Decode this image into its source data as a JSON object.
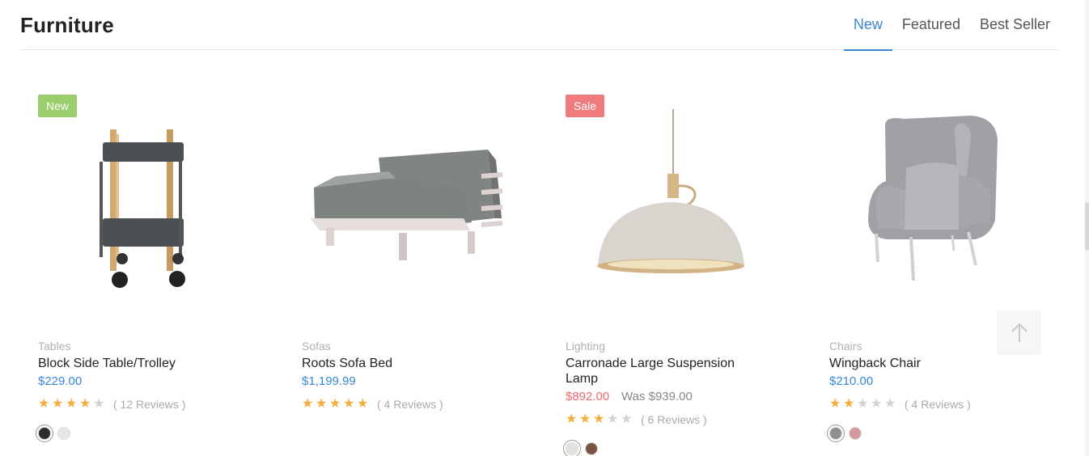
{
  "section": {
    "title": "Furniture",
    "tabs": [
      "New",
      "Featured",
      "Best Seller"
    ],
    "active_tab": "New"
  },
  "products": [
    {
      "badge": "New",
      "category": "Tables",
      "name": "Block Side Table/Trolley",
      "price": "$229.00",
      "rating": 4,
      "reviews": "( 12 Reviews )",
      "swatches": [
        "#2d2d2d",
        "#e6e6e6"
      ],
      "image": "trolley-image"
    },
    {
      "badge": "",
      "category": "Sofas",
      "name": "Roots Sofa Bed",
      "price": "$1,199.99",
      "rating": 5,
      "reviews": "( 4 Reviews )",
      "swatches": [],
      "image": "sofa-bed-image"
    },
    {
      "badge": "Sale",
      "category": "Lighting",
      "name": "Carronade Large Suspension Lamp",
      "price": "$892.00",
      "was_price": "Was $939.00",
      "rating": 3,
      "reviews": "( 6 Reviews )",
      "swatches": [
        "#e4e2dd",
        "#7a5443"
      ],
      "image": "pendant-lamp-image"
    },
    {
      "badge": "",
      "category": "Chairs",
      "name": "Wingback Chair",
      "price": "$210.00",
      "rating": 2,
      "reviews": "( 4 Reviews )",
      "swatches": [
        "#8f8f8f",
        "#d49a9a"
      ],
      "image": "wingback-chair-image"
    }
  ],
  "back_to_top": "arrow-up-icon",
  "colors": {
    "accent": "#3a87d6",
    "sale": "#ee6b6b",
    "new_badge": "#9acd6b",
    "star": "#f5ad3b"
  }
}
